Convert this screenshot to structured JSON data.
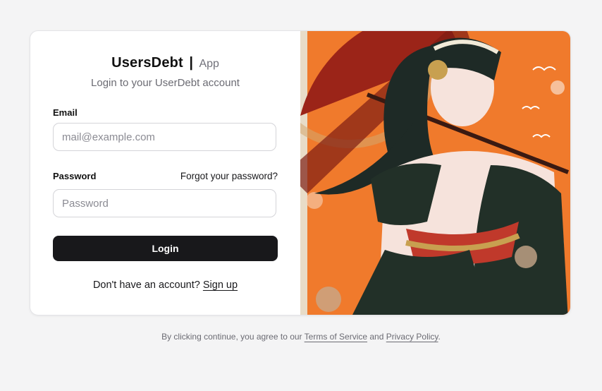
{
  "header": {
    "brand_name": "UsersDebt",
    "separator": "|",
    "brand_suffix": "App",
    "subtitle": "Login to your UserDebt account"
  },
  "form": {
    "email_label": "Email",
    "email_placeholder": "mail@example.com",
    "email_value": "",
    "password_label": "Password",
    "forgot_password": "Forgot your password?",
    "password_placeholder": "Password",
    "password_value": "",
    "login_button": "Login"
  },
  "signup": {
    "prompt": "Don't have an account?",
    "link": "Sign up"
  },
  "footer": {
    "prefix": "By clicking continue, you agree to our",
    "terms": "Terms of Service",
    "and": "and",
    "privacy": "Privacy Policy",
    "suffix": "."
  },
  "illustration": {
    "subject": "anime-woman-with-red-parasol",
    "colors": {
      "background": "#f07a2c",
      "parasol": "#9b2418",
      "kimono": "#223028",
      "hair": "#1e2a26",
      "skin": "#f6e3dc",
      "accent": "#c0392b",
      "left_strip": "#e8dcc8"
    }
  },
  "theme": {
    "page_bg": "#f4f4f5",
    "card_bg": "#ffffff",
    "button_bg": "#18181b",
    "muted_text": "#6b6b73"
  }
}
